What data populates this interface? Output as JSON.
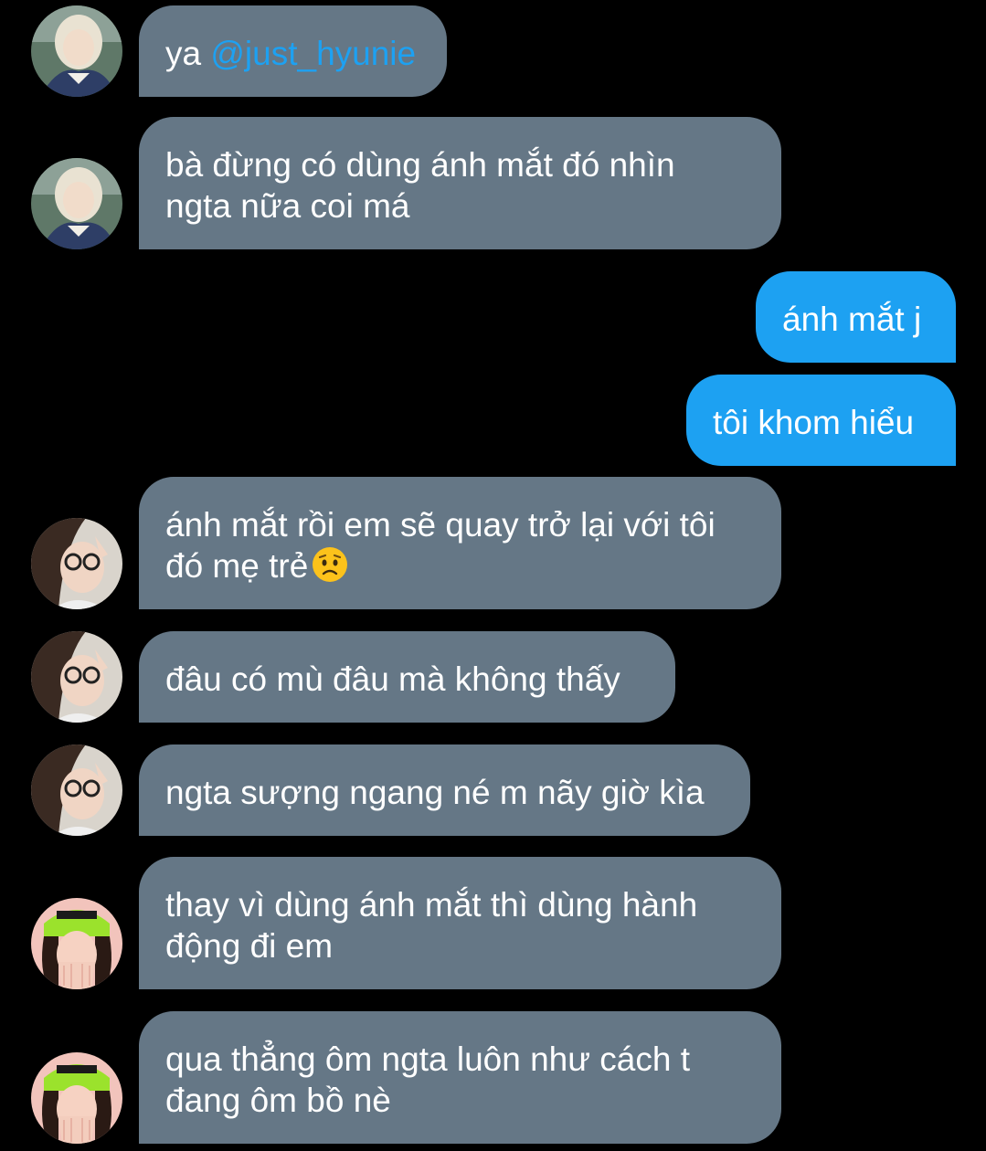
{
  "messages": [
    {
      "id": 1,
      "direction": "in",
      "avatar": "blonde-girl-avatar",
      "text": "ya ",
      "mention": "@just_hyunie"
    },
    {
      "id": 2,
      "direction": "in",
      "avatar": "blonde-girl-avatar",
      "lines": [
        "bà đừng có dùng ánh mắt đó nhìn",
        "ngta nữa coi má"
      ]
    },
    {
      "id": 3,
      "direction": "out",
      "text": "ánh mắt j"
    },
    {
      "id": 4,
      "direction": "out",
      "text": "tôi khom hiểu"
    },
    {
      "id": 5,
      "direction": "in",
      "avatar": "glasses-girl-avatar",
      "lines": [
        "ánh mắt rồi em sẽ quay trở lại với tôi",
        "đó mẹ trẻ"
      ],
      "emoji": "worried-face-emoji"
    },
    {
      "id": 6,
      "direction": "in",
      "avatar": "glasses-girl-avatar",
      "text": "đâu có mù đâu mà không thấy"
    },
    {
      "id": 7,
      "direction": "in",
      "avatar": "glasses-girl-avatar",
      "text": "ngta sượng ngang né m nãy giờ kìa"
    },
    {
      "id": 8,
      "direction": "in",
      "avatar": "green-beanie-girl-avatar",
      "lines": [
        "thay vì dùng ánh mắt thì dùng hành",
        "động đi em"
      ]
    },
    {
      "id": 9,
      "direction": "in",
      "avatar": "green-beanie-girl-avatar",
      "lines": [
        "qua thẳng ôm ngta luôn như cách t",
        "đang ôm bồ nè"
      ]
    }
  ],
  "colors": {
    "background": "#000000",
    "incoming_bubble": "#657786",
    "outgoing_bubble": "#1da1f2",
    "mention": "#1da1f2",
    "text": "#ffffff"
  }
}
